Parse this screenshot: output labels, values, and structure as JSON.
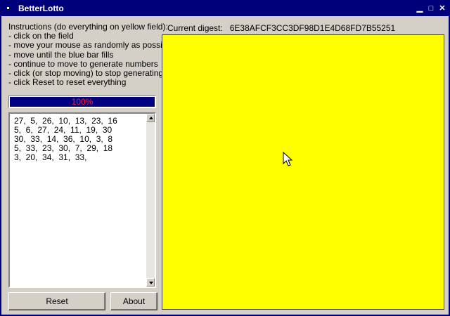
{
  "window": {
    "title": "BetterLotto",
    "minimize_glyph": "▁",
    "maximize_glyph": "□",
    "close_glyph": "✕"
  },
  "instructions": [
    "Instructions (do everything on yellow field):",
    "- click on the field",
    "- move your mouse as randomly as possible",
    "- move until the blue bar fills",
    "- continue to move to generate numbers",
    "- click (or stop moving) to stop generating",
    "- click Reset to reset everything"
  ],
  "progress": {
    "value": 1.0,
    "label": "100%"
  },
  "numbers": [
    "27,  5,  26,  10,  13,  23,  16",
    "5,  6,  27,  24,  11,  19,  30",
    "30,  33,  14,  36,  10,  3,  8",
    "5,  33,  23,  30,  7,  29,  18",
    "3,  20,  34,  31,  33,"
  ],
  "buttons": {
    "reset": "Reset",
    "about": "About"
  },
  "digest": {
    "label": "Current digest:",
    "value": "6E38AFCF3CC3DF98D1E4D68FD7B55251"
  },
  "colors": {
    "field": "#ffff00",
    "progress_fill": "#000080",
    "titlebar": "#00007a"
  }
}
